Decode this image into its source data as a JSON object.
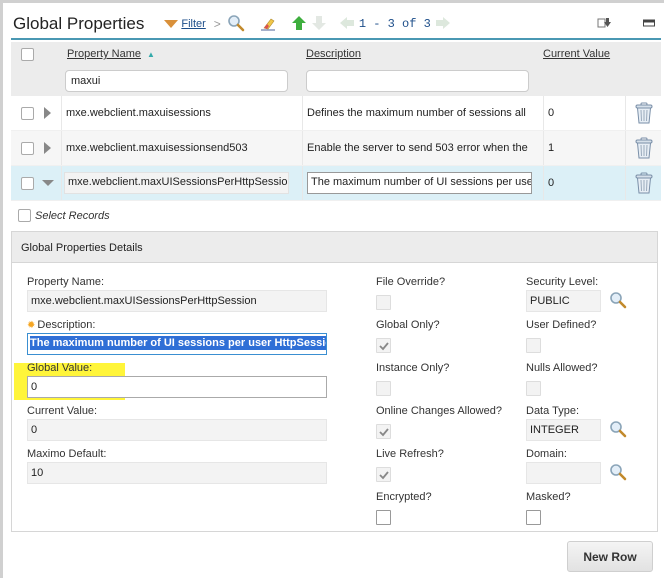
{
  "toolbar": {
    "title": "Global Properties",
    "filter_label": "Filter",
    "pager_text": "1 - 3 of 3",
    "icons": [
      "filter-icon",
      "search-icon",
      "clear-filter-icon",
      "arrow-up-icon",
      "arrow-down-icon",
      "previous-page-icon",
      "next-page-icon",
      "download-icon",
      "minimize-icon"
    ]
  },
  "table": {
    "columns": {
      "property_name": "Property Name",
      "description": "Description",
      "current_value": "Current Value"
    },
    "filters": {
      "property_name": "maxui",
      "description": ""
    },
    "rows": [
      {
        "name": "mxe.webclient.maxuisessions",
        "description": "Defines the maximum number of sessions all",
        "current_value": "0",
        "expanded": false
      },
      {
        "name": "mxe.webclient.maxuisessionsend503",
        "description": "Enable the server to send 503 error when the",
        "current_value": "1",
        "expanded": false
      },
      {
        "name": "mxe.webclient.maxUISessionsPerHttpSession",
        "description": "The maximum number of UI sessions per use",
        "current_value": "0",
        "expanded": true
      }
    ],
    "select_records_label": "Select Records"
  },
  "details": {
    "title": "Global Properties Details",
    "property_name_label": "Property Name:",
    "property_name_value": "mxe.webclient.maxUISessionsPerHttpSession",
    "description_label": "Description:",
    "description_value": "The maximum number of UI sessions per user HttpSession. A",
    "global_value_label": "Global Value:",
    "global_value_value": "0",
    "current_value_label": "Current Value:",
    "current_value_value": "0",
    "maximo_default_label": "Maximo Default:",
    "maximo_default_value": "10",
    "file_override_label": "File Override?",
    "file_override_checked": false,
    "global_only_label": "Global Only?",
    "global_only_checked": true,
    "instance_only_label": "Instance Only?",
    "instance_only_checked": false,
    "online_changes_label": "Online Changes Allowed?",
    "online_changes_checked": true,
    "live_refresh_label": "Live Refresh?",
    "live_refresh_checked": true,
    "encrypted_label": "Encrypted?",
    "encrypted_checked": false,
    "security_level_label": "Security Level:",
    "security_level_value": "PUBLIC",
    "user_defined_label": "User Defined?",
    "user_defined_checked": false,
    "nulls_allowed_label": "Nulls Allowed?",
    "nulls_allowed_checked": false,
    "data_type_label": "Data Type:",
    "data_type_value": "INTEGER",
    "domain_label": "Domain:",
    "domain_value": "",
    "masked_label": "Masked?",
    "masked_checked": false
  },
  "buttons": {
    "new_row": "New Row"
  },
  "colors": {
    "accent": "#4a98b3",
    "selected_row": "#dcf0f7",
    "highlight": "#fff53a",
    "link": "#1d4e8a"
  }
}
